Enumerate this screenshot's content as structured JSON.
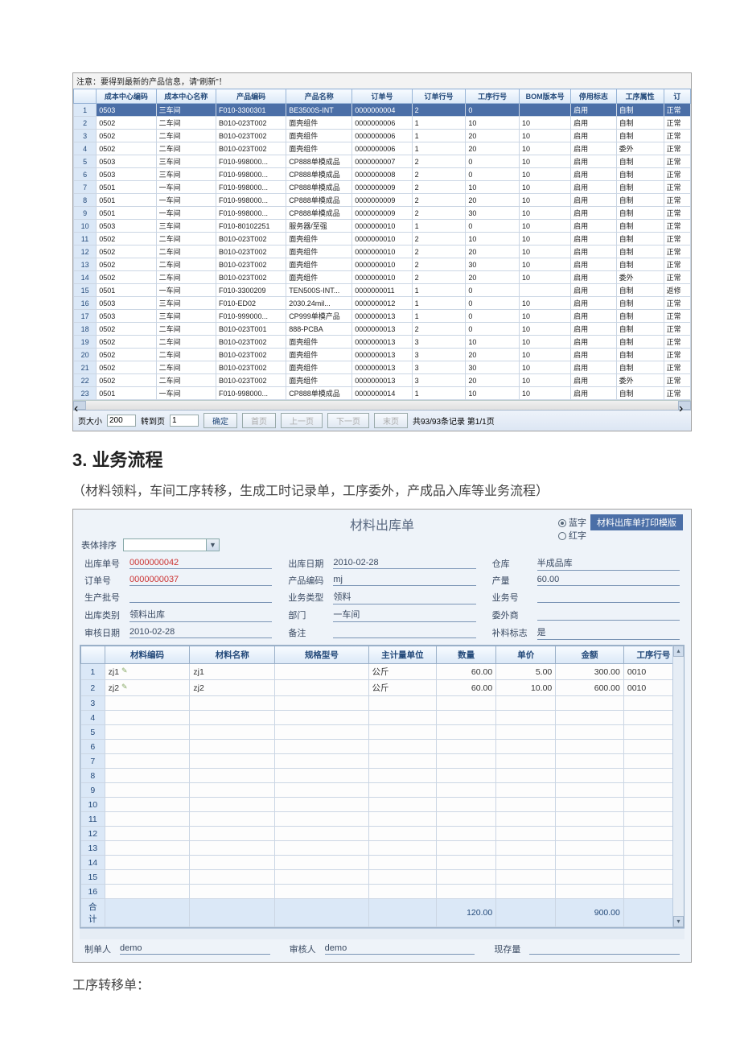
{
  "grid1": {
    "notice": "注意：要得到最新的产品信息，请“刷新”！",
    "headers": [
      "",
      "成本中心编码",
      "成本中心名称",
      "产品编码",
      "产品名称",
      "订单号",
      "订单行号",
      "工序行号",
      "BOM版本号",
      "停用标志",
      "工序属性",
      "订"
    ],
    "rows": [
      {
        "n": "1",
        "selected": true,
        "c": [
          "0503",
          "三车间",
          "F010-3300301",
          "BE3500S-INT",
          "0000000004",
          "2",
          "0",
          "",
          "启用",
          "自制",
          "正常"
        ]
      },
      {
        "n": "2",
        "c": [
          "0502",
          "二车间",
          "B010-023T002",
          "面壳组件",
          "0000000006",
          "1",
          "10",
          "10",
          "启用",
          "自制",
          "正常"
        ]
      },
      {
        "n": "3",
        "c": [
          "0502",
          "二车间",
          "B010-023T002",
          "面壳组件",
          "0000000006",
          "1",
          "20",
          "10",
          "启用",
          "自制",
          "正常"
        ]
      },
      {
        "n": "4",
        "c": [
          "0502",
          "二车间",
          "B010-023T002",
          "面壳组件",
          "0000000006",
          "1",
          "20",
          "10",
          "启用",
          "委外",
          "正常"
        ]
      },
      {
        "n": "5",
        "c": [
          "0503",
          "三车间",
          "F010-998000...",
          "CP888单模成品",
          "0000000007",
          "2",
          "0",
          "10",
          "启用",
          "自制",
          "正常"
        ]
      },
      {
        "n": "6",
        "c": [
          "0503",
          "三车间",
          "F010-998000...",
          "CP888单模成品",
          "0000000008",
          "2",
          "0",
          "10",
          "启用",
          "自制",
          "正常"
        ]
      },
      {
        "n": "7",
        "c": [
          "0501",
          "一车间",
          "F010-998000...",
          "CP888单模成品",
          "0000000009",
          "2",
          "10",
          "10",
          "启用",
          "自制",
          "正常"
        ]
      },
      {
        "n": "8",
        "c": [
          "0501",
          "一车间",
          "F010-998000...",
          "CP888单模成品",
          "0000000009",
          "2",
          "20",
          "10",
          "启用",
          "自制",
          "正常"
        ]
      },
      {
        "n": "9",
        "c": [
          "0501",
          "一车间",
          "F010-998000...",
          "CP888单模成品",
          "0000000009",
          "2",
          "30",
          "10",
          "启用",
          "自制",
          "正常"
        ]
      },
      {
        "n": "10",
        "c": [
          "0503",
          "三车间",
          "F010-80102251",
          "服务器/至强",
          "0000000010",
          "1",
          "0",
          "10",
          "启用",
          "自制",
          "正常"
        ]
      },
      {
        "n": "11",
        "c": [
          "0502",
          "二车间",
          "B010-023T002",
          "面壳组件",
          "0000000010",
          "2",
          "10",
          "10",
          "启用",
          "自制",
          "正常"
        ]
      },
      {
        "n": "12",
        "c": [
          "0502",
          "二车间",
          "B010-023T002",
          "面壳组件",
          "0000000010",
          "2",
          "20",
          "10",
          "启用",
          "自制",
          "正常"
        ]
      },
      {
        "n": "13",
        "c": [
          "0502",
          "二车间",
          "B010-023T002",
          "面壳组件",
          "0000000010",
          "2",
          "30",
          "10",
          "启用",
          "自制",
          "正常"
        ]
      },
      {
        "n": "14",
        "c": [
          "0502",
          "二车间",
          "B010-023T002",
          "面壳组件",
          "0000000010",
          "2",
          "20",
          "10",
          "启用",
          "委外",
          "正常"
        ]
      },
      {
        "n": "15",
        "c": [
          "0501",
          "一车间",
          "F010-3300209",
          "TEN500S-INT...",
          "0000000011",
          "1",
          "0",
          "",
          "启用",
          "自制",
          "返修"
        ]
      },
      {
        "n": "16",
        "c": [
          "0503",
          "三车间",
          "F010-ED02",
          "2030.24mil...",
          "0000000012",
          "1",
          "0",
          "10",
          "启用",
          "自制",
          "正常"
        ]
      },
      {
        "n": "17",
        "c": [
          "0503",
          "三车间",
          "F010-999000...",
          "CP999单模产品",
          "0000000013",
          "1",
          "0",
          "10",
          "启用",
          "自制",
          "正常"
        ]
      },
      {
        "n": "18",
        "c": [
          "0502",
          "二车间",
          "B010-023T001",
          "888-PCBA",
          "0000000013",
          "2",
          "0",
          "10",
          "启用",
          "自制",
          "正常"
        ]
      },
      {
        "n": "19",
        "c": [
          "0502",
          "二车间",
          "B010-023T002",
          "面壳组件",
          "0000000013",
          "3",
          "10",
          "10",
          "启用",
          "自制",
          "正常"
        ]
      },
      {
        "n": "20",
        "c": [
          "0502",
          "二车间",
          "B010-023T002",
          "面壳组件",
          "0000000013",
          "3",
          "20",
          "10",
          "启用",
          "自制",
          "正常"
        ]
      },
      {
        "n": "21",
        "c": [
          "0502",
          "二车间",
          "B010-023T002",
          "面壳组件",
          "0000000013",
          "3",
          "30",
          "10",
          "启用",
          "自制",
          "正常"
        ]
      },
      {
        "n": "22",
        "c": [
          "0502",
          "二车间",
          "B010-023T002",
          "面壳组件",
          "0000000013",
          "3",
          "20",
          "10",
          "启用",
          "委外",
          "正常"
        ]
      },
      {
        "n": "23",
        "c": [
          "0501",
          "一车间",
          "F010-998000...",
          "CP888单模成品",
          "0000000014",
          "1",
          "10",
          "10",
          "启用",
          "自制",
          "正常"
        ]
      }
    ],
    "foot": {
      "pagesize_lb": "页大小",
      "pagesize": "200",
      "goto_lb": "转到页",
      "goto": "1",
      "ok": "确定",
      "first": "首页",
      "prev": "上一页",
      "next": "下一页",
      "last": "末页",
      "summary": "共93/93条记录 第1/1页"
    }
  },
  "section": {
    "heading_no": "3.",
    "heading": "业务流程",
    "desc": "（材料领料，车间工序转移，生成工时记录单，工序委外，产成品入库等业务流程）",
    "after": "工序转移单："
  },
  "form": {
    "title": "材料出库单",
    "badge": "材料出库单打印模版",
    "sort_lb": "表体排序",
    "radio_blue": "蓝字",
    "radio_red": "红字",
    "fields": {
      "out_no_lb": "出库单号",
      "out_no": "0000000042",
      "out_date_lb": "出库日期",
      "out_date": "2010-02-28",
      "store_lb": "仓库",
      "store": "半成品库",
      "order_lb": "订单号",
      "order": "0000000037",
      "prod_code_lb": "产品编码",
      "prod_code": "mj",
      "qty_lb": "产量",
      "qty": "60.00",
      "batch_lb": "生产批号",
      "batch": "",
      "biz_type_lb": "业务类型",
      "biz_type": "领料",
      "biz_no_lb": "业务号",
      "biz_no": "",
      "out_kind_lb": "出库类别",
      "out_kind": "领料出库",
      "dept_lb": "部门",
      "dept": "一车间",
      "outsrc_lb": "委外商",
      "outsrc": "",
      "audit_date_lb": "审核日期",
      "audit_date": "2010-02-28",
      "remark_lb": "备注",
      "remark": "",
      "supply_lb": "补料标志",
      "supply": "是"
    },
    "grid_headers": [
      "",
      "材料编码",
      "材料名称",
      "规格型号",
      "主计量单位",
      "数量",
      "单价",
      "金额",
      "工序行号"
    ],
    "grid_rows": [
      {
        "n": "1",
        "code": "zj1",
        "name": "zj1",
        "spec": "",
        "unit": "公斤",
        "qty": "60.00",
        "price": "5.00",
        "amt": "300.00",
        "line": "0010"
      },
      {
        "n": "2",
        "code": "zj2",
        "name": "zj2",
        "spec": "",
        "unit": "公斤",
        "qty": "60.00",
        "price": "10.00",
        "amt": "600.00",
        "line": "0010"
      }
    ],
    "empty_rows": [
      "3",
      "4",
      "5",
      "6",
      "7",
      "8",
      "9",
      "10",
      "11",
      "12",
      "13",
      "14",
      "15",
      "16"
    ],
    "total_lb": "合计",
    "total_qty": "120.00",
    "total_amt": "900.00",
    "foot": {
      "maker_lb": "制单人",
      "maker": "demo",
      "auditor_lb": "审核人",
      "auditor": "demo",
      "stock_lb": "现存量",
      "stock": ""
    }
  }
}
